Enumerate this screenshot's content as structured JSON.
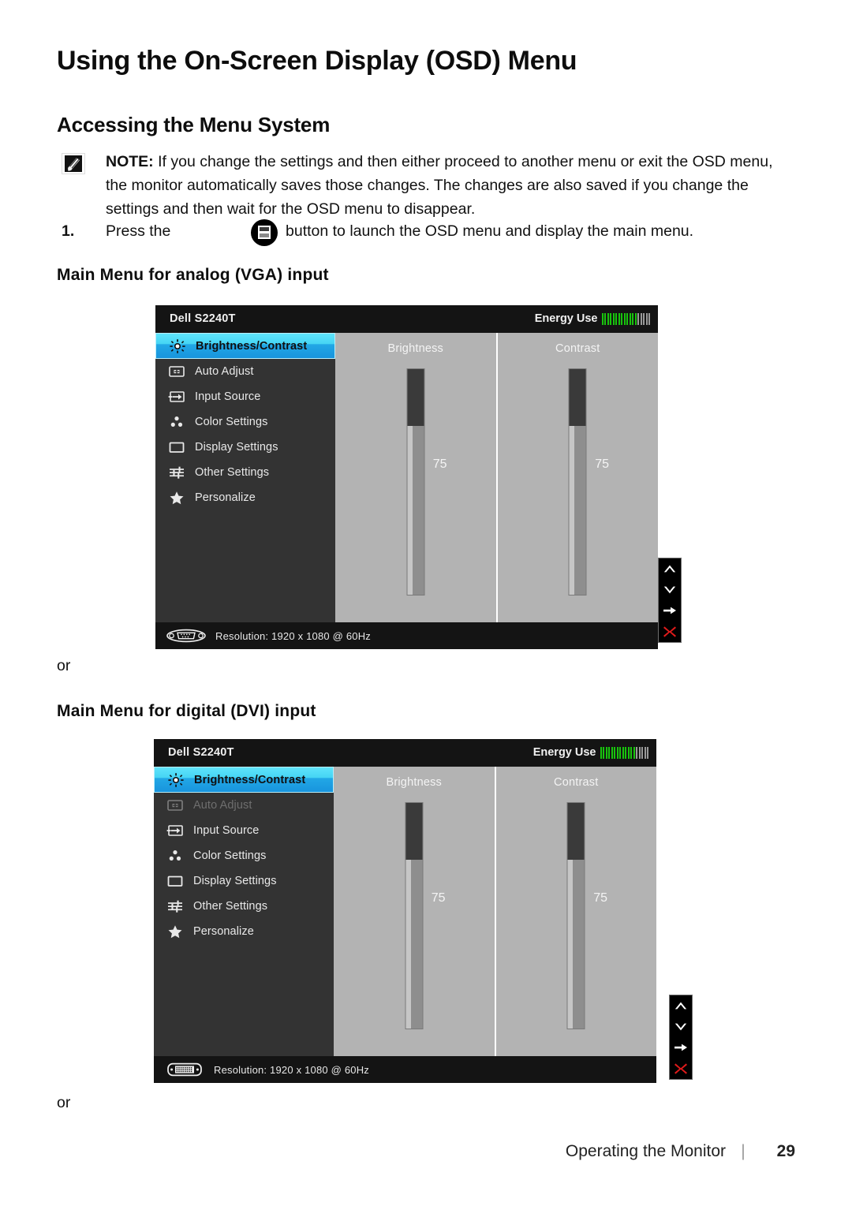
{
  "page": {
    "title": "Using the On-Screen Display (OSD) Menu",
    "section_title": "Accessing the Menu System",
    "note_label": "NOTE:",
    "note_text": " If you change the settings and then either proceed to another menu or exit the OSD menu, the monitor automatically saves those changes. The changes are also saved if you change the settings and then wait for the OSD menu to disappear.",
    "step_number": "1.",
    "step_text_before": "Press the",
    "step_text_after": "button to launch the OSD menu and display the main menu.",
    "subhead_vga": "Main Menu for analog (VGA) input",
    "subhead_dvi": "Main Menu for digital (DVI) input",
    "or_1": "or",
    "or_2": "or",
    "footer_label": "Operating the Monitor",
    "footer_separator": "|",
    "page_number": "29"
  },
  "colors": {
    "selected_highlight": "#45d4f4",
    "energy_green": "#18c40d",
    "energy_grey": "#9a9a9a",
    "close_red": "#e01b1b",
    "panel_bg": "#1a1a1a",
    "sidebar_bg": "#333333",
    "content_bg": "#b3b3b3"
  },
  "osd_vga": {
    "model": "Dell S2240T",
    "energy_label": "Energy Use",
    "energy_filled": 13,
    "energy_total": 18,
    "menu_items": [
      {
        "label": "Brightness/Contrast",
        "icon": "brightness-icon",
        "selected": true,
        "disabled": false
      },
      {
        "label": "Auto Adjust",
        "icon": "auto-adjust-icon",
        "selected": false,
        "disabled": false
      },
      {
        "label": "Input Source",
        "icon": "input-source-icon",
        "selected": false,
        "disabled": false
      },
      {
        "label": "Color Settings",
        "icon": "color-settings-icon",
        "selected": false,
        "disabled": false
      },
      {
        "label": "Display Settings",
        "icon": "display-settings-icon",
        "selected": false,
        "disabled": false
      },
      {
        "label": "Other Settings",
        "icon": "other-settings-icon",
        "selected": false,
        "disabled": false
      },
      {
        "label": "Personalize",
        "icon": "star-icon",
        "selected": false,
        "disabled": false
      }
    ],
    "sliders": [
      {
        "label": "Brightness",
        "value": "75",
        "percent": 75
      },
      {
        "label": "Contrast",
        "value": "75",
        "percent": 75
      }
    ],
    "connector_icon": "vga-connector-icon",
    "resolution": "Resolution: 1920 x 1080 @ 60Hz",
    "nav_buttons": [
      {
        "icon": "chevron-up-icon",
        "label": "up"
      },
      {
        "icon": "chevron-down-icon",
        "label": "down"
      },
      {
        "icon": "arrow-right-icon",
        "label": "enter"
      },
      {
        "icon": "close-x-icon",
        "label": "exit"
      }
    ]
  },
  "osd_dvi": {
    "model": "Dell S2240T",
    "energy_label": "Energy Use",
    "energy_filled": 13,
    "energy_total": 18,
    "menu_items": [
      {
        "label": "Brightness/Contrast",
        "icon": "brightness-icon",
        "selected": true,
        "disabled": false
      },
      {
        "label": "Auto Adjust",
        "icon": "auto-adjust-icon",
        "selected": false,
        "disabled": true
      },
      {
        "label": "Input Source",
        "icon": "input-source-icon",
        "selected": false,
        "disabled": false
      },
      {
        "label": "Color Settings",
        "icon": "color-settings-icon",
        "selected": false,
        "disabled": false
      },
      {
        "label": "Display Settings",
        "icon": "display-settings-icon",
        "selected": false,
        "disabled": false
      },
      {
        "label": "Other Settings",
        "icon": "other-settings-icon",
        "selected": false,
        "disabled": false
      },
      {
        "label": "Personalize",
        "icon": "star-icon",
        "selected": false,
        "disabled": false
      }
    ],
    "sliders": [
      {
        "label": "Brightness",
        "value": "75",
        "percent": 75
      },
      {
        "label": "Contrast",
        "value": "75",
        "percent": 75
      }
    ],
    "connector_icon": "dvi-connector-icon",
    "resolution": "Resolution: 1920 x 1080 @ 60Hz",
    "nav_buttons": [
      {
        "icon": "chevron-up-icon",
        "label": "up"
      },
      {
        "icon": "chevron-down-icon",
        "label": "down"
      },
      {
        "icon": "arrow-right-icon",
        "label": "enter"
      },
      {
        "icon": "close-x-icon",
        "label": "exit"
      }
    ]
  }
}
